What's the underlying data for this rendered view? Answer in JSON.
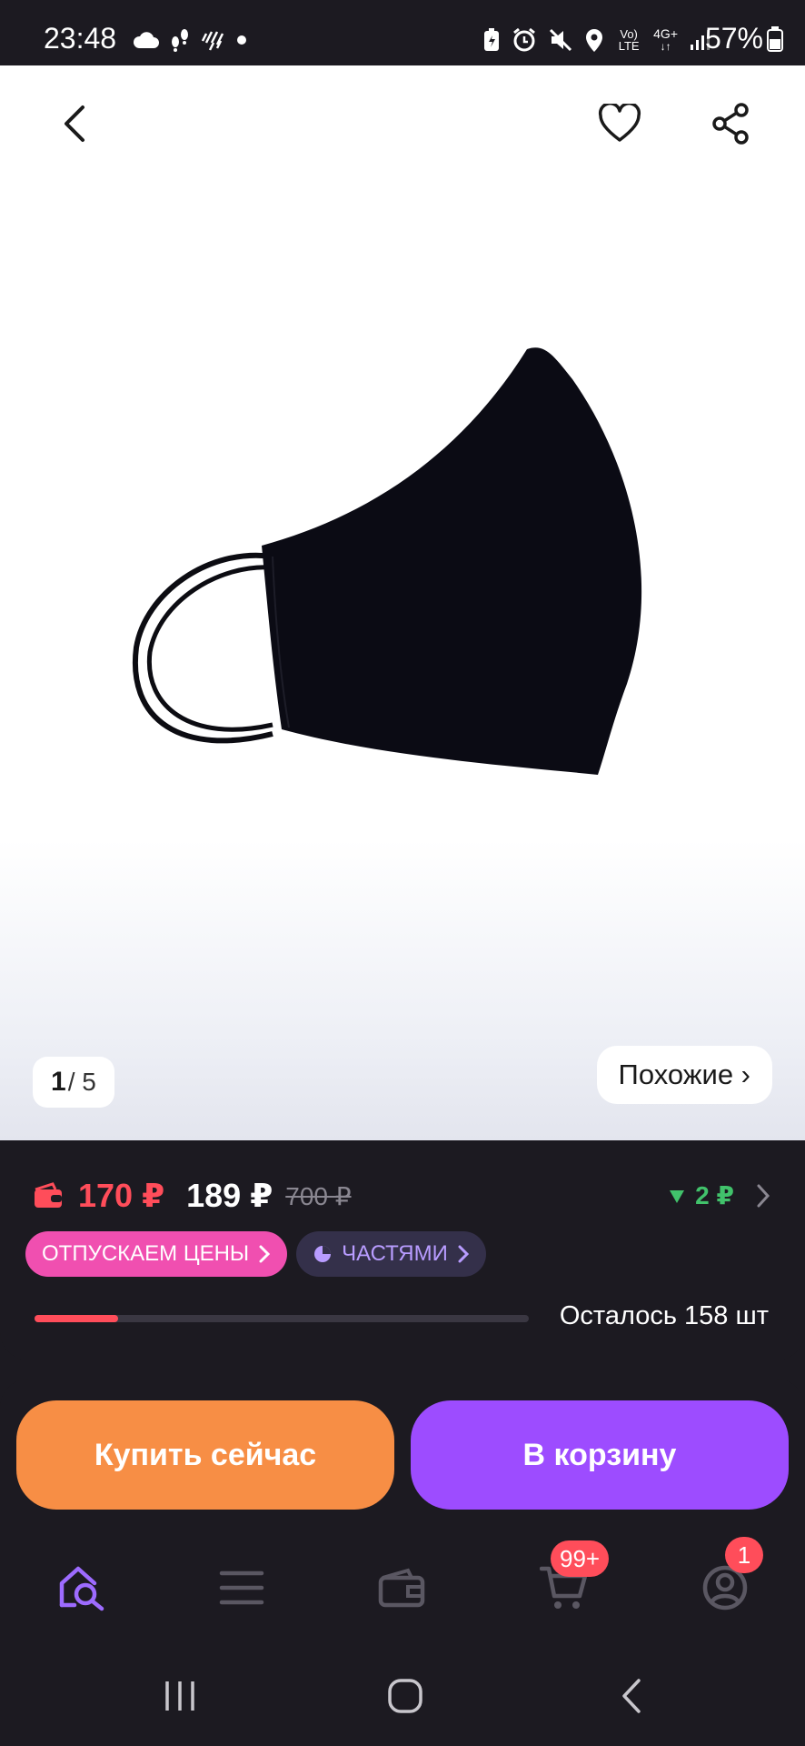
{
  "status_bar": {
    "time": "23:48",
    "battery": "57%",
    "signal_label": "4G+",
    "volte_label": "Vo) LTE"
  },
  "gallery": {
    "current": "1",
    "total": "/ 5",
    "similar_label": "Похожие ›"
  },
  "price": {
    "wallet_price": "170 ₽",
    "price": "189 ₽",
    "old_price": "700 ₽",
    "drop": "2 ₽",
    "accent_color": "#ff4d5a",
    "drop_color": "#41c26b"
  },
  "pills": {
    "discount_label": "ОТПУСКАЕМ ЦЕНЫ",
    "installments_label": "ЧАСТЯМИ"
  },
  "stock": {
    "remaining_label": "Осталось 158 шт",
    "progress_fraction": 0.17
  },
  "actions": {
    "buy_now": "Купить сейчас",
    "add_to_cart": "В корзину",
    "buy_color": "#f78e45",
    "cart_color": "#9d4cff"
  },
  "bottom_nav": {
    "items": [
      {
        "icon": "home-search-icon",
        "active": true
      },
      {
        "icon": "catalog-menu-icon",
        "active": false
      },
      {
        "icon": "wallet-icon",
        "active": false
      },
      {
        "icon": "cart-icon",
        "active": false
      },
      {
        "icon": "profile-icon",
        "active": false
      }
    ],
    "cart_badge": "99+",
    "profile_badge": "1",
    "active_color": "#9d6bff"
  }
}
